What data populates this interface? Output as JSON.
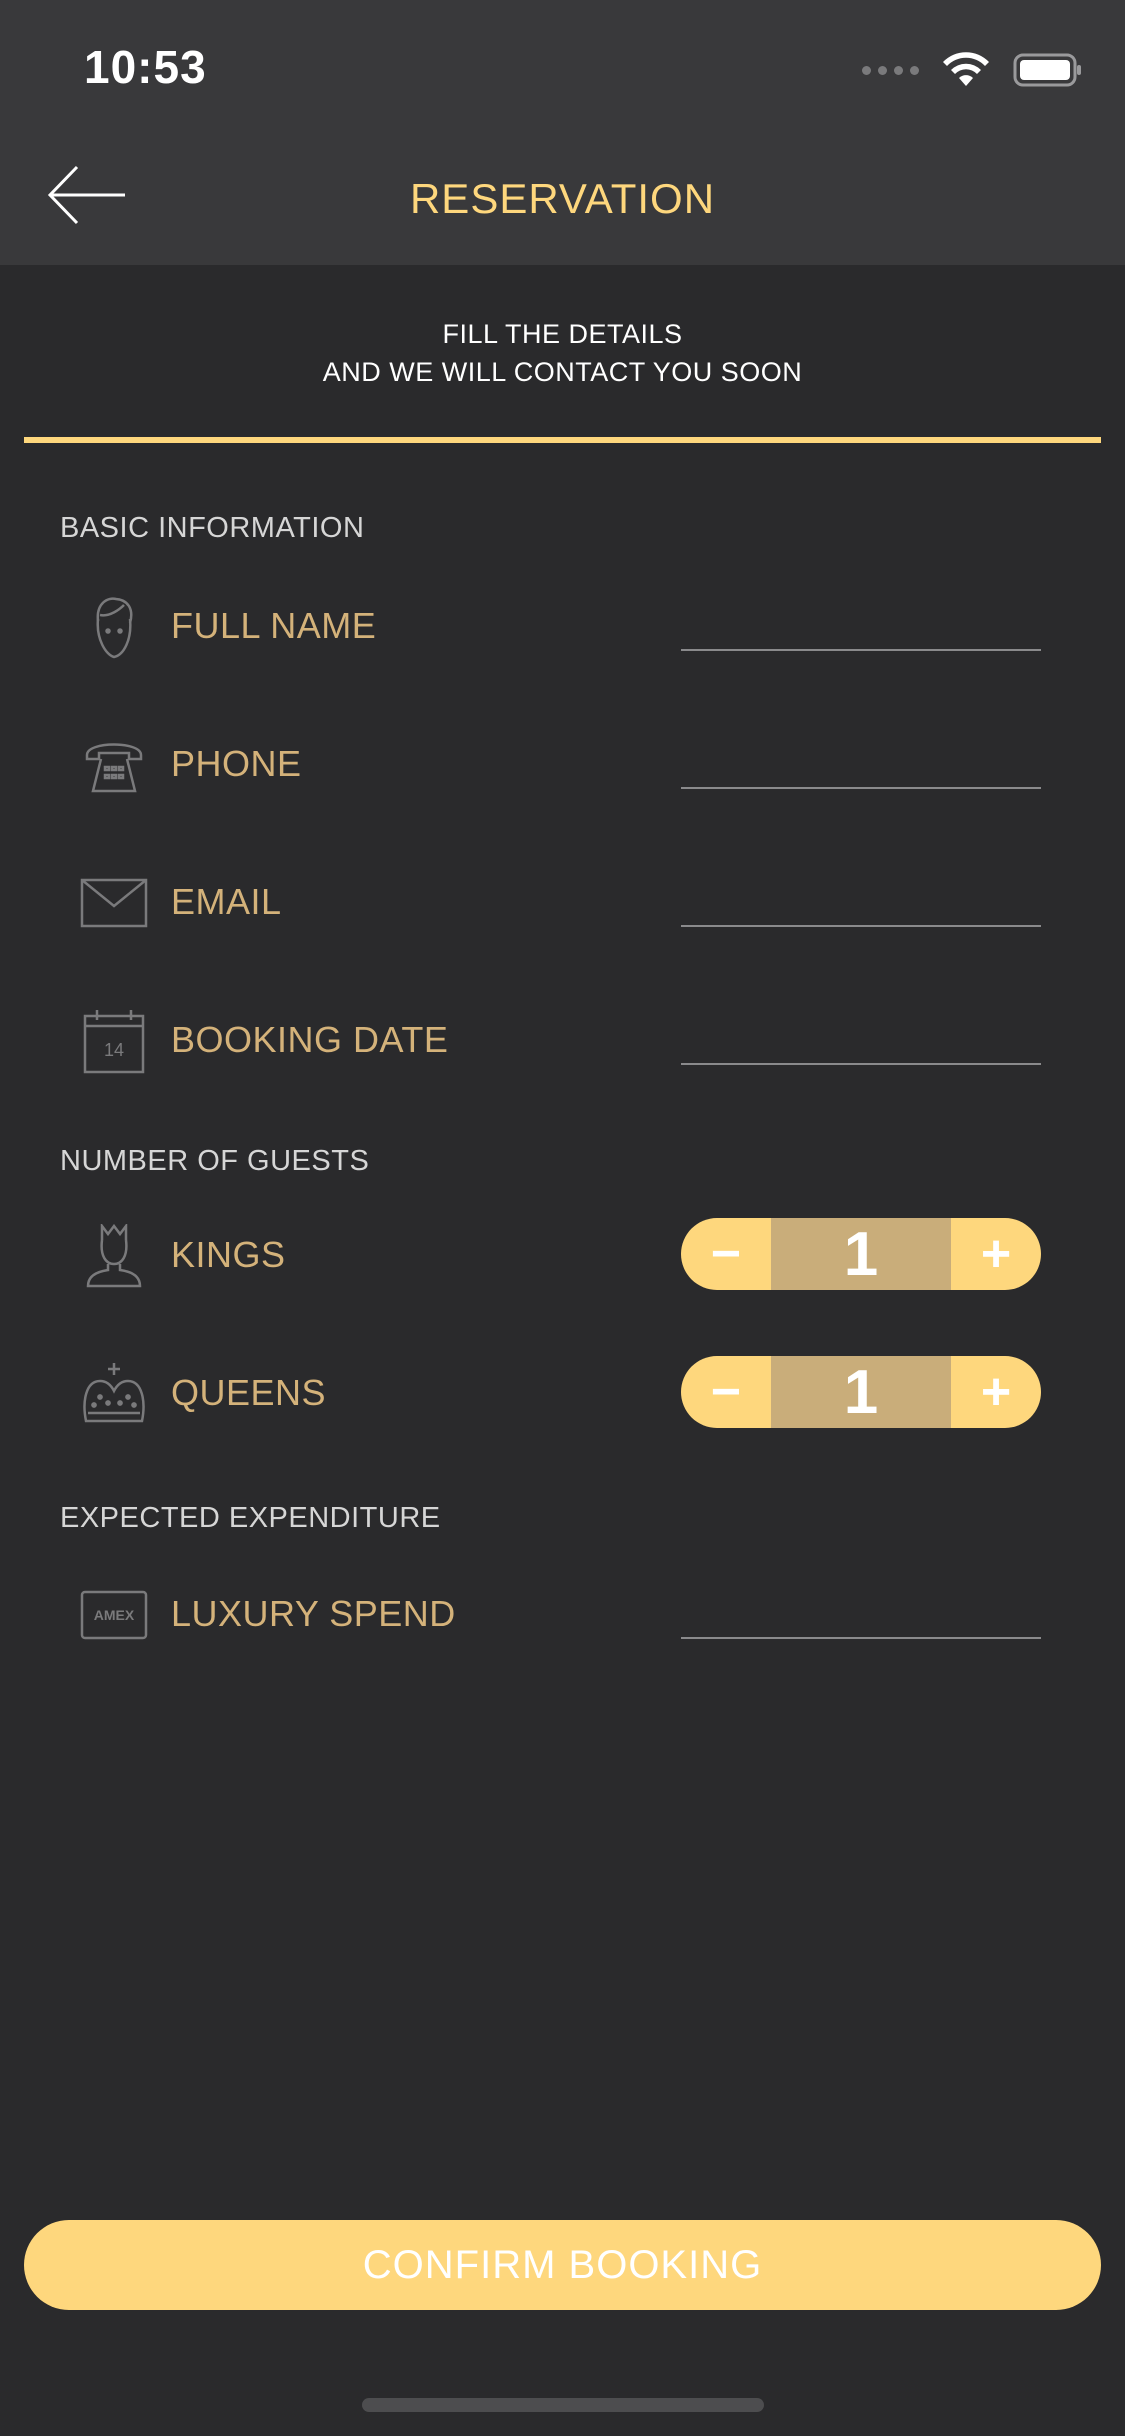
{
  "status_bar": {
    "time": "10:53"
  },
  "nav": {
    "title": "RESERVATION"
  },
  "intro": {
    "line1": "FILL THE DETAILS",
    "line2": "AND WE WILL CONTACT YOU SOON"
  },
  "sections": {
    "basic": "BASIC INFORMATION",
    "guests": "NUMBER OF GUESTS",
    "expenditure": "EXPECTED EXPENDITURE"
  },
  "fields": {
    "full_name": {
      "label": "FULL NAME",
      "value": "",
      "icon": "person-icon"
    },
    "phone": {
      "label": "PHONE",
      "value": "",
      "icon": "telephone-icon"
    },
    "email": {
      "label": "EMAIL",
      "value": "",
      "icon": "envelope-icon"
    },
    "booking_date": {
      "label": "BOOKING DATE",
      "value": "",
      "icon": "calendar-icon",
      "icon_text": "14"
    },
    "luxury_spend": {
      "label": "LUXURY SPEND",
      "value": "",
      "icon": "amex-card-icon",
      "icon_text": "AMEX"
    }
  },
  "guests": {
    "kings": {
      "label": "KINGS",
      "count": "1",
      "icon": "king-icon"
    },
    "queens": {
      "label": "QUEENS",
      "count": "1",
      "icon": "crown-icon"
    },
    "minus_symbol": "−",
    "plus_symbol": "+"
  },
  "confirm": {
    "label": "CONFIRM BOOKING"
  },
  "colors": {
    "accent": "#fed77d",
    "label_gold": "#d4b27a",
    "stepper_mid": "#c9ad7a",
    "background": "#2a2a2c",
    "header": "#39393b"
  }
}
